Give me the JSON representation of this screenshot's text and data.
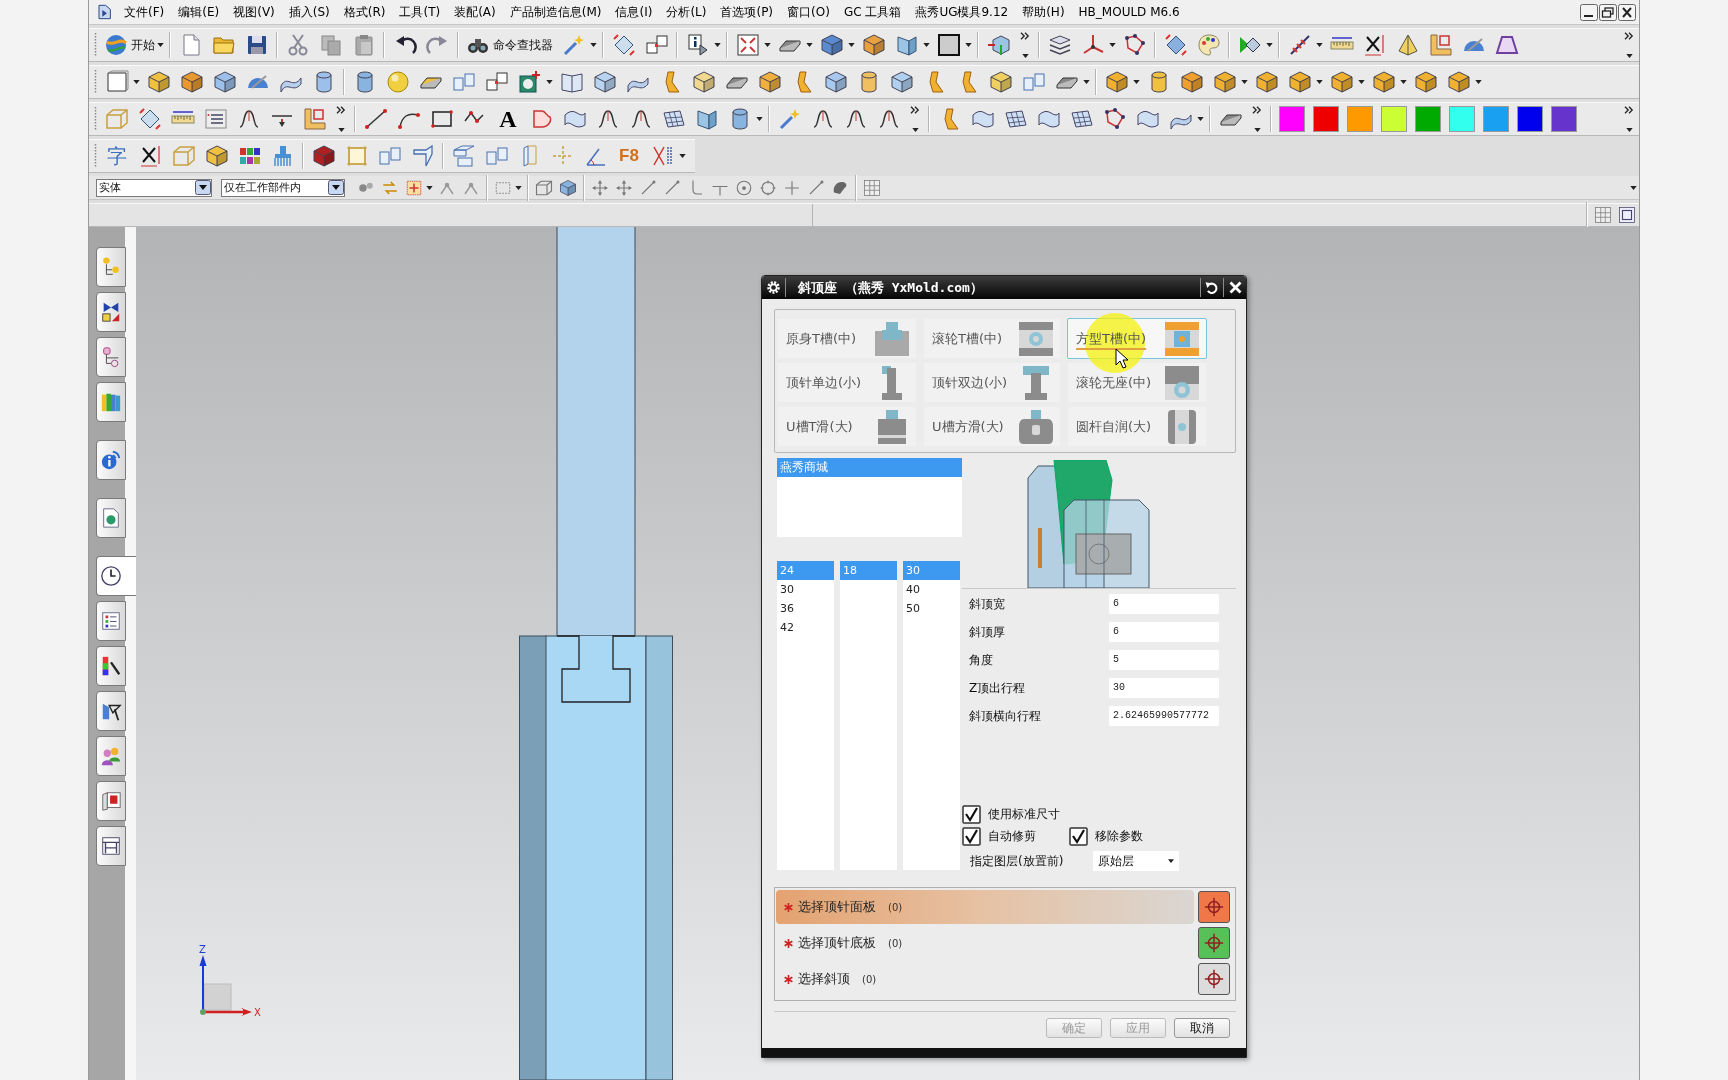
{
  "menu_bar": {
    "items": [
      "文件(F)",
      "编辑(E)",
      "视图(V)",
      "插入(S)",
      "格式(R)",
      "工具(T)",
      "装配(A)",
      "产品制造信息(M)",
      "信息(I)",
      "分析(L)",
      "首选项(P)",
      "窗口(O)",
      "GC 工具箱",
      "燕秀UG模具9.12",
      "帮助(H)",
      "HB_MOULD M6.6"
    ]
  },
  "toolbar": {
    "start_label": "开始",
    "command_finder_label": "命令查找器",
    "text_tool": "A",
    "character_tool": "字",
    "function_key_tool": "F8"
  },
  "color_swatches": [
    {
      "color": "#ff00ff"
    },
    {
      "color": "#ee0000"
    },
    {
      "color": "#ff9900"
    },
    {
      "color": "#ccff33"
    },
    {
      "color": "#00aa00"
    },
    {
      "color": "#33ffee"
    },
    {
      "color": "#1aa0f0"
    },
    {
      "color": "#0000ee"
    },
    {
      "color": "#6633cc"
    }
  ],
  "selection_bar": {
    "type_filter": "实体",
    "scope_filter": "仅在工作部件内"
  },
  "resource_bar": {
    "tabs": [
      {
        "selected": false
      },
      {
        "selected": false
      },
      {
        "selected": false
      },
      {
        "selected": false
      },
      {
        "selected": false
      },
      {
        "selected": false
      },
      {
        "selected": true
      },
      {
        "selected": false
      },
      {
        "selected": false
      },
      {
        "selected": false
      },
      {
        "selected": false
      },
      {
        "selected": false
      },
      {
        "selected": false
      }
    ]
  },
  "dialog": {
    "title": "斜顶座 （燕秀 YxMold.com）",
    "types": [
      {
        "label": "原身T槽(中)",
        "selected": false
      },
      {
        "label": "滚轮T槽(中)",
        "selected": false
      },
      {
        "label": "方型T槽(中)",
        "selected": true
      },
      {
        "label": "顶针单边(小)",
        "selected": false
      },
      {
        "label": "顶针双边(小)",
        "selected": false
      },
      {
        "label": "滚轮无座(中)",
        "selected": false
      },
      {
        "label": "U槽T滑(大)",
        "selected": false
      },
      {
        "label": "U槽方滑(大)",
        "selected": false
      },
      {
        "label": "圆杆自润(大)",
        "selected": false
      }
    ],
    "catalog_list": [
      {
        "label": "燕秀商城",
        "selected": true
      }
    ],
    "size_lists": [
      {
        "items": [
          {
            "label": "24",
            "selected": true
          },
          {
            "label": "30",
            "selected": false
          },
          {
            "label": "36",
            "selected": false
          },
          {
            "label": "42",
            "selected": false
          }
        ]
      },
      {
        "items": [
          {
            "label": "18",
            "selected": true
          }
        ]
      },
      {
        "items": [
          {
            "label": "30",
            "selected": true
          },
          {
            "label": "40",
            "selected": false
          },
          {
            "label": "50",
            "selected": false
          }
        ]
      }
    ],
    "parameters": [
      {
        "label": "斜顶宽",
        "value": "6"
      },
      {
        "label": "斜顶厚",
        "value": "6"
      },
      {
        "label": "角度",
        "value": "5"
      },
      {
        "label": "Z顶出行程",
        "value": "30"
      },
      {
        "label": "斜顶横向行程",
        "value": "2.62465990577772"
      }
    ],
    "options": [
      {
        "label": "使用标准尺寸",
        "checked": true
      },
      {
        "label": "自动修剪",
        "checked": true
      },
      {
        "label": "移除参数",
        "checked": true
      }
    ],
    "layer": {
      "label": "指定图层(放置前)",
      "value": "原始层"
    },
    "selections": [
      {
        "label": "选择顶针面板",
        "count": "(0)",
        "active": true,
        "color": "#f07848"
      },
      {
        "label": "选择顶针底板",
        "count": "(0)",
        "active": false,
        "color": "#58c058"
      },
      {
        "label": "选择斜顶",
        "count": "(0)",
        "active": false,
        "color": "#dcdcdc"
      }
    ],
    "buttons": [
      {
        "label": "确定",
        "disabled": true
      },
      {
        "label": "应用",
        "disabled": true
      },
      {
        "label": "取消",
        "disabled": false
      }
    ]
  },
  "axis_triad": {
    "z_label": "Z",
    "x_label": "X"
  }
}
